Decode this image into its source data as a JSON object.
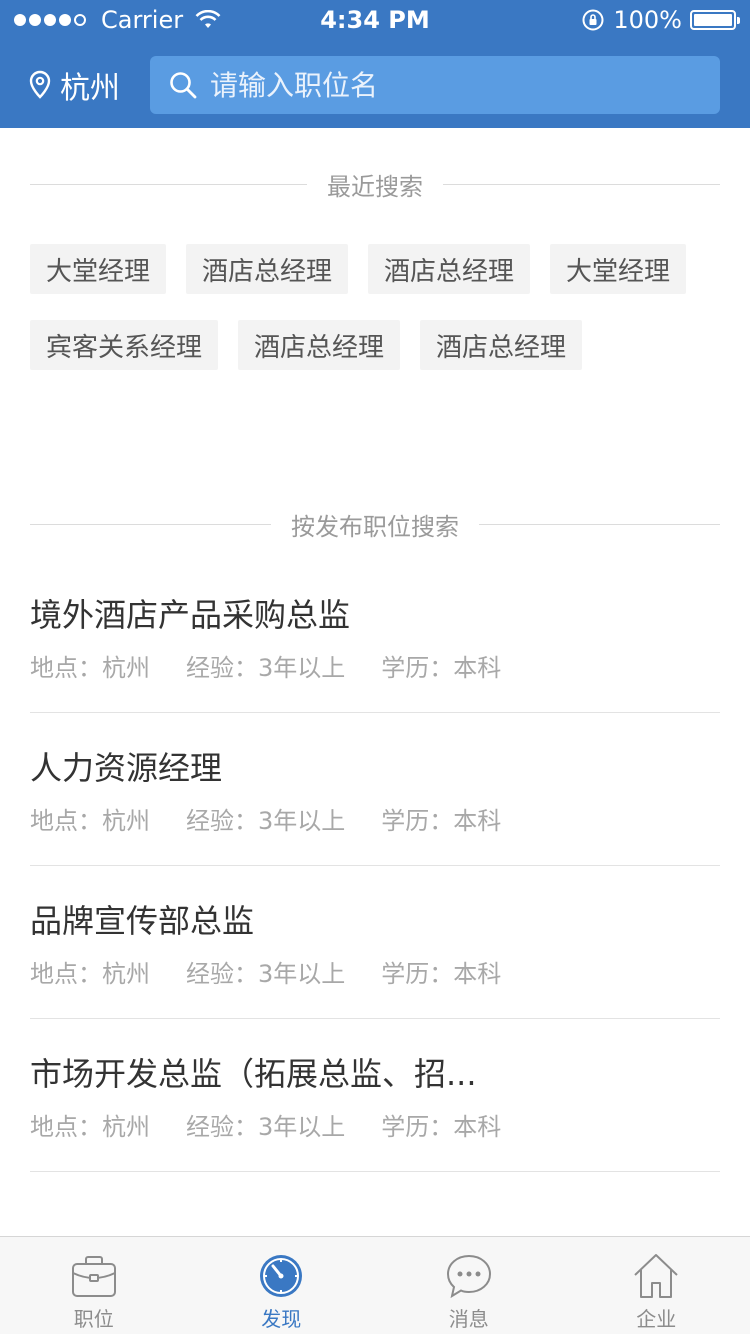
{
  "status_bar": {
    "carrier": "Carrier",
    "time": "4:34 PM",
    "battery": "100%"
  },
  "header": {
    "city": "杭州",
    "search_placeholder": "请输入职位名"
  },
  "recent_search": {
    "title": "最近搜索",
    "tags": [
      "大堂经理",
      "酒店总经理",
      "酒店总经理",
      "大堂经理",
      "宾客关系经理",
      "酒店总经理",
      "酒店总经理"
    ]
  },
  "posted_search": {
    "title": "按发布职位搜索",
    "jobs": [
      {
        "title": "境外酒店产品采购总监",
        "location": "地点：杭州",
        "experience": "经验：3年以上",
        "education": "学历：本科"
      },
      {
        "title": "人力资源经理",
        "location": "地点：杭州",
        "experience": "经验：3年以上",
        "education": "学历：本科"
      },
      {
        "title": "品牌宣传部总监",
        "location": "地点：杭州",
        "experience": "经验：3年以上",
        "education": "学历：本科"
      },
      {
        "title": "市场开发总监（拓展总监、招...",
        "location": "地点：杭州",
        "experience": "经验：3年以上",
        "education": "学历：本科"
      }
    ]
  },
  "tabbar": {
    "items": [
      {
        "label": "职位",
        "icon": "briefcase-icon"
      },
      {
        "label": "发现",
        "icon": "compass-icon"
      },
      {
        "label": "消息",
        "icon": "chat-bubble-icon"
      },
      {
        "label": "企业",
        "icon": "home-icon"
      }
    ],
    "active_index": 1
  },
  "colors": {
    "primary": "#3a78c3",
    "search_bg": "#5a9ce2",
    "tag_bg": "#f3f3f3"
  }
}
